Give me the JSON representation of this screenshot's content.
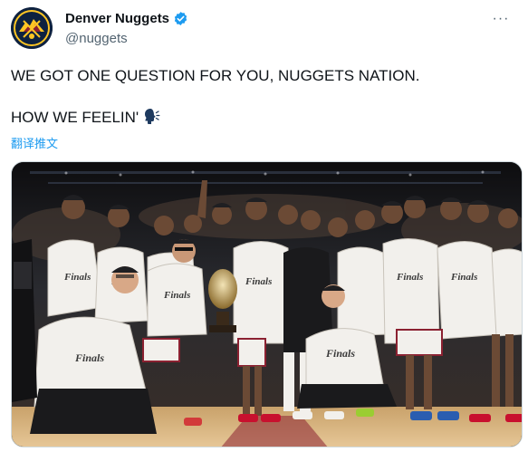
{
  "account": {
    "display_name": "Denver Nuggets",
    "handle": "@nuggets",
    "verified": true,
    "avatar_icon": "nuggets-logo-icon"
  },
  "header": {
    "more_icon": "more-horizontal-icon",
    "more_label": "···"
  },
  "tweet": {
    "line1": "WE GOT ONE QUESTION FOR YOU, NUGGETS NATION.",
    "line2": "HOW WE FEELIN'",
    "emoji_icon": "speaking-head-icon"
  },
  "translate": {
    "label": "翻译推文"
  },
  "media": {
    "type": "photo",
    "shirt_text": "Finals"
  },
  "colors": {
    "brand_navy": "#0e2240",
    "brand_gold": "#fec524",
    "brand_red": "#8b2131",
    "link_blue": "#1d9bf0",
    "secondary_text": "#536471"
  }
}
